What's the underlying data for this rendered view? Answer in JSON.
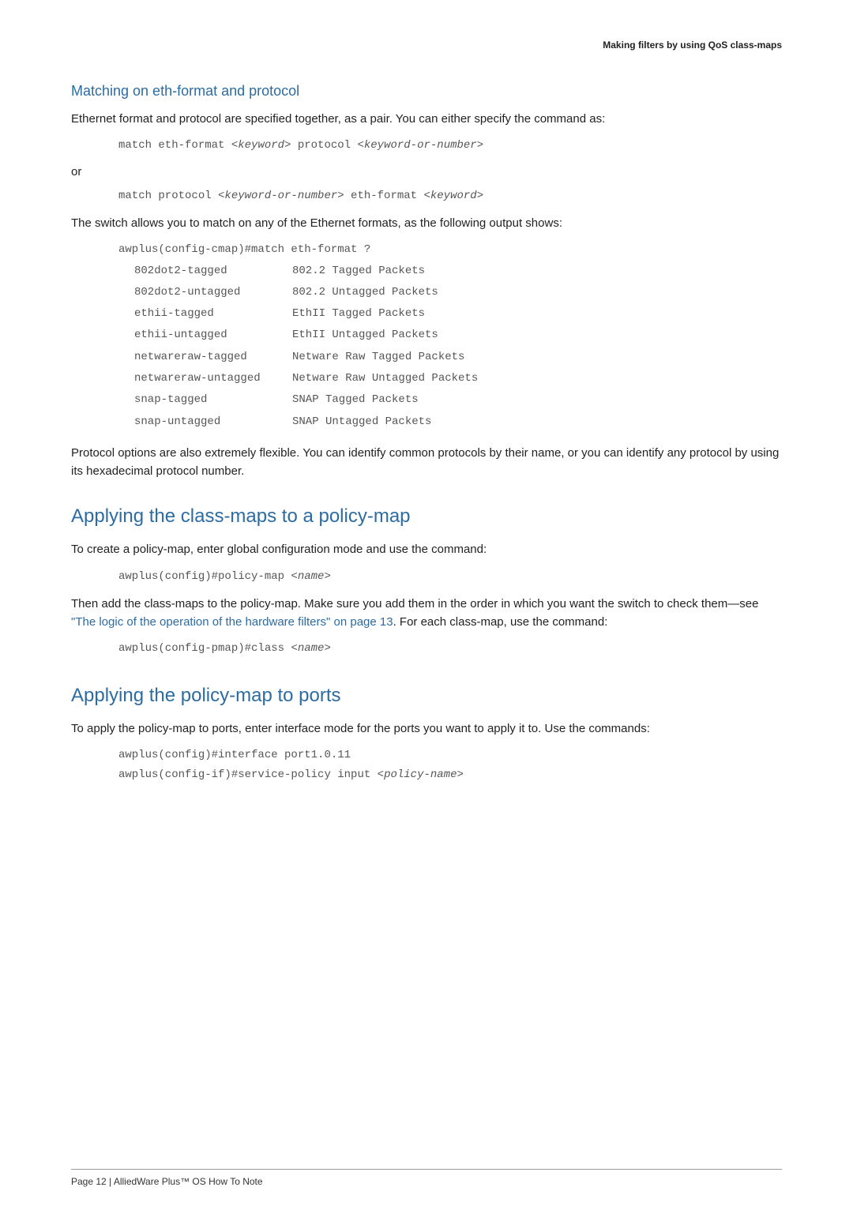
{
  "header": {
    "title": "Making filters by using QoS class-maps"
  },
  "section1": {
    "heading": "Matching on eth-format and protocol",
    "para1": "Ethernet format and protocol are specified together, as a pair. You can either specify the command as:",
    "code1_prefix": "match eth-format <",
    "code1_kw": "keyword",
    "code1_mid": "> protocol <",
    "code1_kw2": "keyword-or-number",
    "code1_suffix": ">",
    "or": "or",
    "code2_prefix": "match protocol <",
    "code2_kw": "keyword-or-number",
    "code2_mid": "> eth-format <",
    "code2_kw2": "keyword",
    "code2_suffix": ">",
    "para2": "The switch allows you to match on any of the Ethernet formats, as the following output shows:",
    "table_header": "awplus(config-cmap)#match eth-format ?",
    "rows": [
      {
        "left": "802dot2-tagged",
        "right": "802.2 Tagged Packets"
      },
      {
        "left": "802dot2-untagged",
        "right": "802.2 Untagged Packets"
      },
      {
        "left": "ethii-tagged",
        "right": "EthII Tagged Packets"
      },
      {
        "left": "ethii-untagged",
        "right": "EthII Untagged Packets"
      },
      {
        "left": "netwareraw-tagged",
        "right": "Netware Raw Tagged Packets"
      },
      {
        "left": "netwareraw-untagged",
        "right": "Netware Raw Untagged Packets"
      },
      {
        "left": "snap-tagged",
        "right": "SNAP Tagged Packets"
      },
      {
        "left": "snap-untagged",
        "right": "SNAP Untagged Packets"
      }
    ],
    "para3": "Protocol options are also extremely flexible. You can identify common protocols by their name, or you can identify any protocol by using its hexadecimal protocol number."
  },
  "section2": {
    "heading": "Applying the class-maps to a policy-map",
    "para1": "To create a policy-map, enter global configuration mode and use the command:",
    "code1_prefix": "awplus(config)#policy-map <",
    "code1_kw": "name",
    "code1_suffix": ">",
    "para2_pre": "Then add the class-maps to the policy-map. Make sure you add them in the order in which you want the switch to check them—see ",
    "para2_link": "\"The logic of the operation of the hardware filters\" on page 13",
    "para2_post": ". For each class-map, use the command:",
    "code2_prefix": "awplus(config-pmap)#class <",
    "code2_kw": "name",
    "code2_suffix": ">"
  },
  "section3": {
    "heading": "Applying the policy-map to ports",
    "para1": "To apply the policy-map to ports, enter interface mode for the ports you want to apply it to. Use the commands:",
    "code1": "awplus(config)#interface port1.0.11",
    "code2_prefix": "awplus(config-if)#service-policy input <",
    "code2_kw": "policy-name",
    "code2_suffix": ">"
  },
  "footer": {
    "text": "Page 12 | AlliedWare Plus™ OS How To Note"
  }
}
